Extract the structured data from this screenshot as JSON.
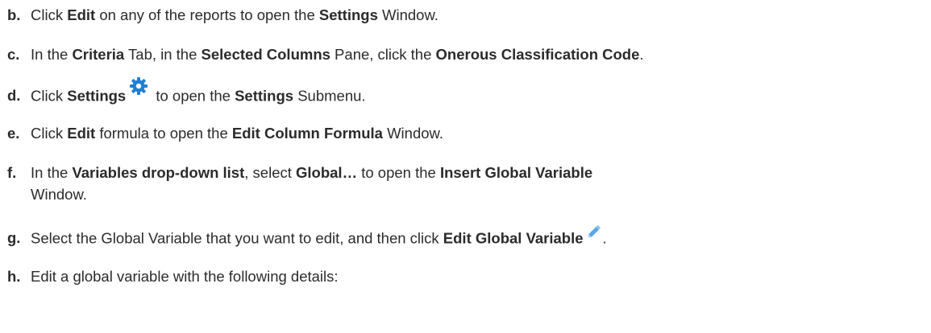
{
  "steps": [
    {
      "letter": "b.",
      "parts": [
        "Click ",
        "Edit",
        " on any of the reports to open the ",
        "Settings",
        " Window."
      ]
    },
    {
      "letter": "c.",
      "parts": [
        "In the ",
        "Criteria",
        " Tab, in the ",
        "Selected Columns",
        " Pane, click the ",
        "Onerous Classification Code",
        "."
      ]
    },
    {
      "letter": "d.",
      "parts": [
        "Click ",
        "Settings",
        " to open the ",
        "Settings",
        " Submenu."
      ],
      "icon": "settings-gear-icon"
    },
    {
      "letter": "e.",
      "parts": [
        "Click ",
        "Edit",
        " formula to open the ",
        "Edit Column Formula",
        " Window."
      ]
    },
    {
      "letter": "f.",
      "parts": [
        "In the ",
        "Variables drop-down list",
        ", select ",
        "Global…",
        " to open the ",
        "Insert Global Variable"
      ],
      "continuation": "Window."
    },
    {
      "letter": "g.",
      "parts": [
        "Select the Global Variable that you want to edit, and then click ",
        "Edit Global Variable",
        "."
      ],
      "icon": "edit-pencil-icon"
    },
    {
      "letter": "h.",
      "parts": [
        "Edit a global variable with the following details:"
      ]
    }
  ],
  "colors": {
    "text": "#2b2b2b",
    "gear_icon": "#1f7fd6",
    "pencil_icon": "#5aa7e6"
  }
}
